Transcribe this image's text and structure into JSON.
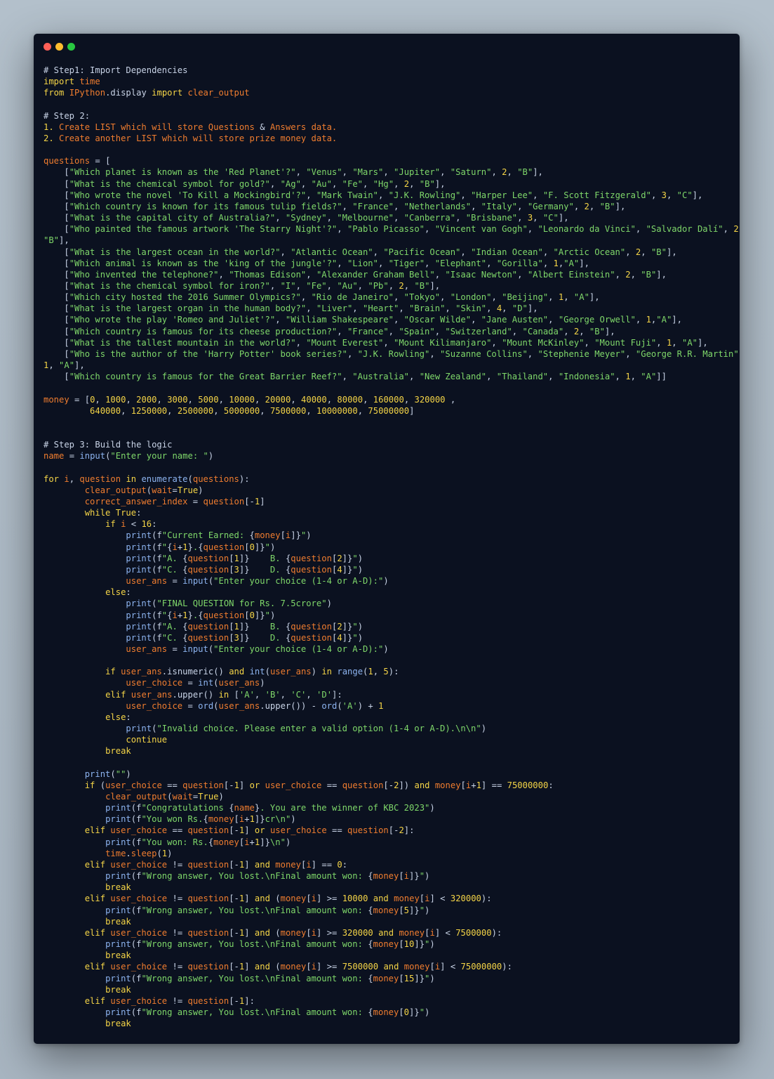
{
  "window": {
    "buttons": [
      "close",
      "minimize",
      "maximize"
    ],
    "colors": {
      "close": "#ff5f57",
      "minimize": "#febc2e",
      "maximize": "#28c840",
      "background": "#0b1120"
    }
  },
  "code": {
    "language": "python",
    "lines": [
      "# Step1: Import Dependencies",
      "import time",
      "from IPython.display import clear_output",
      "",
      "# Step 2:",
      "1. Create LIST which will store Questions & Answers data.",
      "2. Create another LIST which will store prize money data.",
      "",
      "questions = [",
      "    [\"Which planet is known as the 'Red Planet'?\", \"Venus\", \"Mars\", \"Jupiter\", \"Saturn\", 2, \"B\"],",
      "    [\"What is the chemical symbol for gold?\", \"Ag\", \"Au\", \"Fe\", \"Hg\", 2, \"B\"],",
      "    [\"Who wrote the novel 'To Kill a Mockingbird'?\", \"Mark Twain\", \"J.K. Rowling\", \"Harper Lee\", \"F. Scott Fitzgerald\", 3, \"C\"],",
      "    [\"Which country is known for its famous tulip fields?\", \"France\", \"Netherlands\", \"Italy\", \"Germany\", 2, \"B\"],",
      "    [\"What is the capital city of Australia?\", \"Sydney\", \"Melbourne\", \"Canberra\", \"Brisbane\", 3, \"C\"],",
      "    [\"Who painted the famous artwork 'The Starry Night'?\", \"Pablo Picasso\", \"Vincent van Gogh\", \"Leonardo da Vinci\", \"Salvador Dalí\", 2,",
      "\"B\"],",
      "    [\"What is the largest ocean in the world?\", \"Atlantic Ocean\", \"Pacific Ocean\", \"Indian Ocean\", \"Arctic Ocean\", 2, \"B\"],",
      "    [\"Which animal is known as the 'king of the jungle'?\", \"Lion\", \"Tiger\", \"Elephant\", \"Gorilla\", 1,\"A\"],",
      "    [\"Who invented the telephone?\", \"Thomas Edison\", \"Alexander Graham Bell\", \"Isaac Newton\", \"Albert Einstein\", 2, \"B\"],",
      "    [\"What is the chemical symbol for iron?\", \"I\", \"Fe\", \"Au\", \"Pb\", 2, \"B\"],",
      "    [\"Which city hosted the 2016 Summer Olympics?\", \"Rio de Janeiro\", \"Tokyo\", \"London\", \"Beijing\", 1, \"A\"],",
      "    [\"What is the largest organ in the human body?\", \"Liver\", \"Heart\", \"Brain\", \"Skin\", 4, \"D\"],",
      "    [\"Who wrote the play 'Romeo and Juliet'?\", \"William Shakespeare\", \"Oscar Wilde\", \"Jane Austen\", \"George Orwell\", 1,\"A\"],",
      "    [\"Which country is famous for its cheese production?\", \"France\", \"Spain\", \"Switzerland\", \"Canada\", 2, \"B\"],",
      "    [\"What is the tallest mountain in the world?\", \"Mount Everest\", \"Mount Kilimanjaro\", \"Mount McKinley\", \"Mount Fuji\", 1, \"A\"],",
      "    [\"Who is the author of the 'Harry Potter' book series?\", \"J.K. Rowling\", \"Suzanne Collins\", \"Stephenie Meyer\", \"George R.R. Martin\",",
      "1, \"A\"],",
      "    [\"Which country is famous for the Great Barrier Reef?\", \"Australia\", \"New Zealand\", \"Thailand\", \"Indonesia\", 1, \"A\"]]",
      "",
      "money = [0, 1000, 2000, 3000, 5000, 10000, 20000, 40000, 80000, 160000, 320000 ,",
      "         640000, 1250000, 2500000, 5000000, 7500000, 10000000, 75000000]",
      "",
      "",
      "# Step 3: Build the logic",
      "name = input(\"Enter your name: \")",
      "",
      "for i, question in enumerate(questions):",
      "        clear_output(wait=True)",
      "        correct_answer_index = question[-1]",
      "        while True:",
      "            if i < 16:",
      "                print(f\"Current Earned: {money[i]}\")",
      "                print(f\"{i+1}.{question[0]}\")",
      "                print(f\"A. {question[1]}    B. {question[2]}\")",
      "                print(f\"C. {question[3]}    D. {question[4]}\")",
      "                user_ans = input(\"Enter your choice (1-4 or A-D):\")",
      "            else:",
      "                print(\"FINAL QUESTION for Rs. 7.5crore\")",
      "                print(f\"{i+1}.{question[0]}\")",
      "                print(f\"A. {question[1]}    B. {question[2]}\")",
      "                print(f\"C. {question[3]}    D. {question[4]}\")",
      "                user_ans = input(\"Enter your choice (1-4 or A-D):\")",
      "",
      "            if user_ans.isnumeric() and int(user_ans) in range(1, 5):",
      "                user_choice = int(user_ans)",
      "            elif user_ans.upper() in ['A', 'B', 'C', 'D']:",
      "                user_choice = ord(user_ans.upper()) - ord('A') + 1",
      "            else:",
      "                print(\"Invalid choice. Please enter a valid option (1-4 or A-D).\\n\\n\")",
      "                continue",
      "            break",
      "",
      "        print(\"\")",
      "        if (user_choice == question[-1] or user_choice == question[-2]) and money[i+1] == 75000000:",
      "            clear_output(wait=True)",
      "            print(f\"Congratulations {name}. You are the winner of KBC 2023\")",
      "            print(f\"You won Rs.{money[i+1]}cr\\n\")",
      "        elif user_choice == question[-1] or user_choice == question[-2]:",
      "            print(f\"You won: Rs.{money[i+1]}\\n\")",
      "            time.sleep(1)",
      "        elif user_choice != question[-1] and money[i] == 0:",
      "            print(f\"Wrong answer, You lost.\\nFinal amount won: {money[i]}\")",
      "            break",
      "        elif user_choice != question[-1] and (money[i] >= 10000 and money[i] < 320000):",
      "            print(f\"Wrong answer, You lost.\\nFinal amount won: {money[5]}\")",
      "            break",
      "        elif user_choice != question[-1] and (money[i] >= 320000 and money[i] < 7500000):",
      "            print(f\"Wrong answer, You lost.\\nFinal amount won: {money[10]}\")",
      "            break",
      "        elif user_choice != question[-1] and (money[i] >= 7500000 and money[i] < 75000000):",
      "            print(f\"Wrong answer, You lost.\\nFinal amount won: {money[15]}\")",
      "            break",
      "        elif user_choice != question[-1]:",
      "            print(f\"Wrong answer, You lost.\\nFinal amount won: {money[0]}\")",
      "            break"
    ]
  }
}
